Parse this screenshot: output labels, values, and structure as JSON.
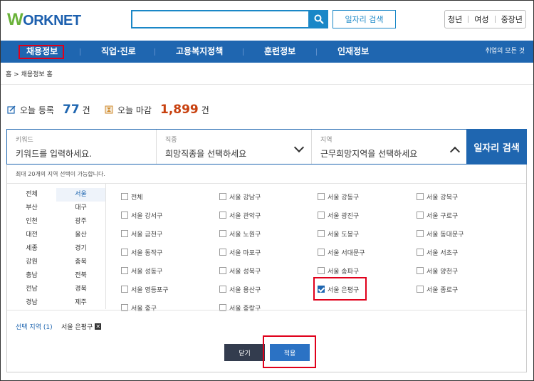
{
  "header": {
    "logo_mark": "W",
    "logo_text": "ORKNET",
    "job_search_label": "일자리 검색",
    "user_tabs": [
      "청년",
      "여성",
      "중장년"
    ]
  },
  "nav": {
    "items": [
      "채용정보",
      "직업·진로",
      "고용복지정책",
      "훈련정보",
      "인재정보"
    ],
    "all_services": "취업의 모든 것"
  },
  "breadcrumb": {
    "home": "홈",
    "current": "채용정보 홈"
  },
  "stats": {
    "today_reg_label": "오늘 등록",
    "today_reg_value": "77",
    "today_close_label": "오늘 마감",
    "today_close_value": "1,899",
    "unit": "건"
  },
  "search": {
    "keyword_label": "키워드",
    "keyword_placeholder": "키워드를 입력하세요.",
    "occupation_label": "직종",
    "occupation_value": "희망직종을 선택하세요",
    "region_label": "지역",
    "region_value": "근무희망지역을 선택하세요",
    "submit_label": "일자리 검색"
  },
  "dropdown": {
    "note": "최대 20개의 지역 선택이 가능합니다.",
    "regions": [
      "전체",
      "서울",
      "부산",
      "대구",
      "인천",
      "광주",
      "대전",
      "울산",
      "세종",
      "경기",
      "강원",
      "충북",
      "충남",
      "전북",
      "전남",
      "경북",
      "경남",
      "제주"
    ],
    "selected_region": "서울",
    "districts": [
      [
        "전체",
        "서울 강남구",
        "서울 강동구",
        "서울 강북구"
      ],
      [
        "서울 강서구",
        "서울 관악구",
        "서울 광진구",
        "서울 구로구"
      ],
      [
        "서울 금천구",
        "서울 노원구",
        "서울 도봉구",
        "서울 동대문구"
      ],
      [
        "서울 동작구",
        "서울 마포구",
        "서울 서대문구",
        "서울 서초구"
      ],
      [
        "서울 성동구",
        "서울 성북구",
        "서울 송파구",
        "서울 양천구"
      ],
      [
        "서울 영등포구",
        "서울 용산구",
        "서울 은평구",
        "서울 종로구"
      ],
      [
        "서울 중구",
        "서울 중랑구"
      ]
    ],
    "checked": "서울 은평구",
    "selected_label": "선택 지역 (1)",
    "selected_item": "서울 은평구",
    "remove_glyph": "✕",
    "close_label": "닫기",
    "apply_label": "적용"
  },
  "colors": {
    "brand_blue": "#1f66b0",
    "highlight_red": "#e0001b",
    "logo_green": "#6ab23a"
  }
}
